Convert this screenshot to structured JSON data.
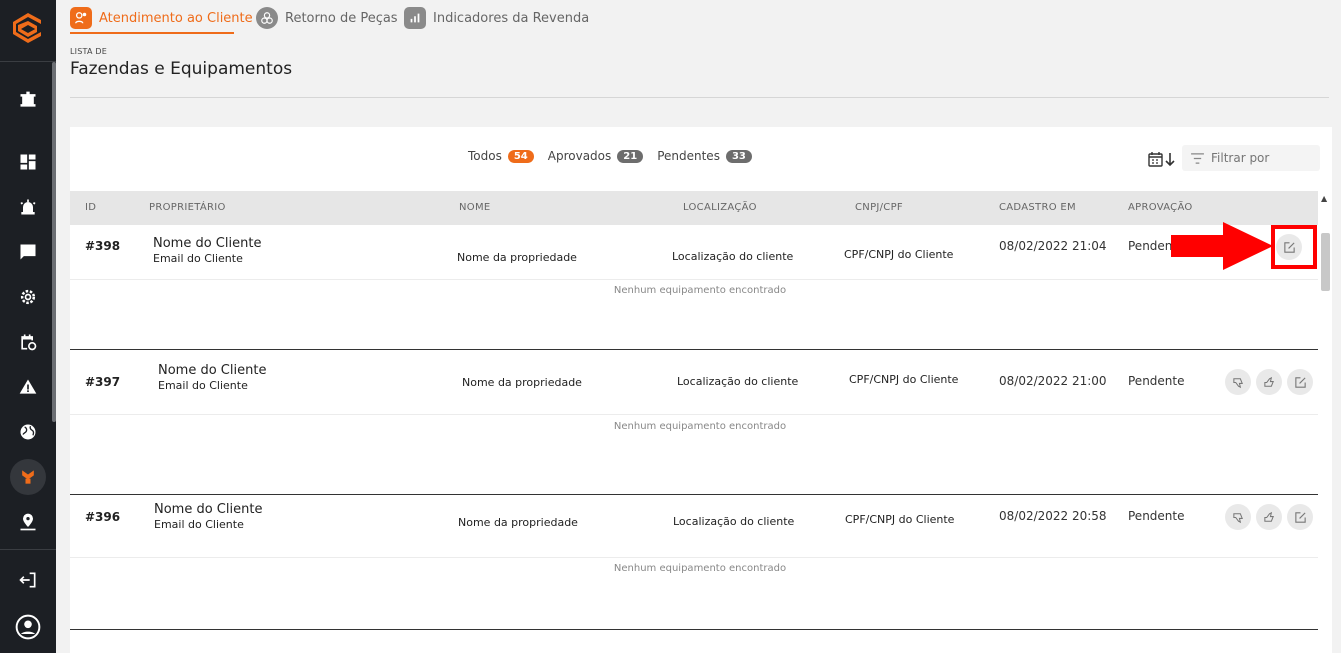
{
  "tabs": [
    {
      "label": "Atendimento ao Cliente",
      "icon": "customer-service-icon",
      "active": true
    },
    {
      "label": "Retorno de Peças",
      "icon": "parts-return-icon",
      "active": false
    },
    {
      "label": "Indicadores da Revenda",
      "icon": "bar-chart-icon",
      "active": false
    }
  ],
  "header": {
    "list_label": "LISTA DE",
    "title": "Fazendas e Equipamentos"
  },
  "filters": {
    "all": {
      "label": "Todos",
      "count": "54"
    },
    "approved": {
      "label": "Aprovados",
      "count": "21"
    },
    "pending": {
      "label": "Pendentes",
      "count": "33"
    },
    "search_placeholder": "Filtrar por"
  },
  "table": {
    "columns": [
      "ID",
      "PROPRIETÁRIO",
      "NOME",
      "LOCALIZAÇÃO",
      "CNPJ/CPF",
      "CADASTRO EM",
      "APROVAÇÃO"
    ],
    "rows": [
      {
        "id": "#398",
        "owner_name": "Nome do Cliente",
        "owner_email": "Email do Cliente",
        "property": "Nome da propriedade",
        "location": "Localização do cliente",
        "doc": "CPF/CNPJ do Cliente",
        "date": "08/02/2022 21:04",
        "status": "Pendente",
        "equipment": "Nenhum equipamento encontrado"
      },
      {
        "id": "#397",
        "owner_name": "Nome do Cliente",
        "owner_email": "Email do Cliente",
        "property": "Nome da propriedade",
        "location": "Localização do cliente",
        "doc": "CPF/CNPJ do Cliente",
        "date": "08/02/2022 21:00",
        "status": "Pendente",
        "equipment": "Nenhum equipamento encontrado"
      },
      {
        "id": "#396",
        "owner_name": "Nome do Cliente",
        "owner_email": "Email do Cliente",
        "property": "Nome da propriedade",
        "location": "Localização do cliente",
        "doc": "CPF/CNPJ do Cliente",
        "date": "08/02/2022 20:58",
        "status": "Pendente",
        "equipment": "Nenhum equipamento encontrado"
      }
    ]
  },
  "colors": {
    "accent": "#ef6c1a",
    "sidebar": "#1c1f24",
    "annotation": "#ff0000"
  }
}
